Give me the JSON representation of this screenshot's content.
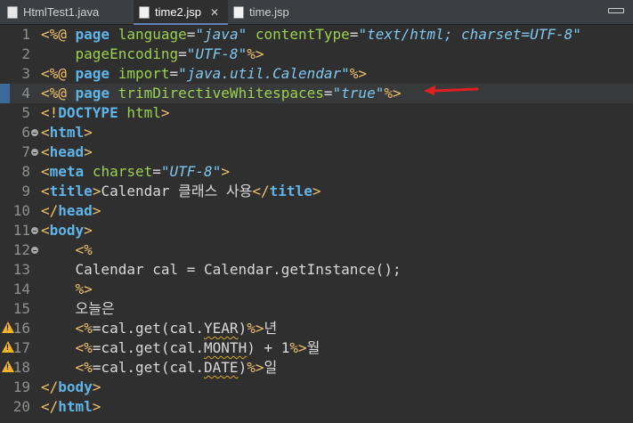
{
  "tabs": [
    {
      "label": "HtmlTest1.java",
      "active": false
    },
    {
      "label": "time2.jsp",
      "active": true,
      "close": "✕"
    },
    {
      "label": "time.jsp",
      "active": false
    }
  ],
  "colors": {
    "directive": "#f0c06a",
    "tag": "#5fb4e8",
    "attribute": "#9bd14f",
    "value": "#7ec7ee",
    "text": "#d9d9d9",
    "arrow": "#e02020",
    "warning": "#f0b323"
  },
  "lines": [
    {
      "num": "1",
      "tokens": [
        [
          "t",
          "<%@ "
        ],
        [
          "tg",
          "page "
        ],
        [
          "a",
          "language"
        ],
        [
          "p",
          "="
        ],
        [
          "v",
          "\"java\""
        ],
        [
          "p",
          " "
        ],
        [
          "a",
          "contentType"
        ],
        [
          "p",
          "="
        ],
        [
          "v",
          "\"text/html; charset=UTF-8\""
        ]
      ]
    },
    {
      "num": "2",
      "tokens": [
        [
          "p",
          "    "
        ],
        [
          "a",
          "pageEncoding"
        ],
        [
          "p",
          "="
        ],
        [
          "v",
          "\"UTF-8\""
        ],
        [
          "t",
          "%>"
        ]
      ]
    },
    {
      "num": "3",
      "tokens": [
        [
          "t",
          "<%@ "
        ],
        [
          "tg",
          "page "
        ],
        [
          "a",
          "import"
        ],
        [
          "p",
          "="
        ],
        [
          "v",
          "\"java.util.Calendar\""
        ],
        [
          "t",
          "%>"
        ]
      ]
    },
    {
      "num": "4",
      "current": true,
      "marker": true,
      "tokens": [
        [
          "t",
          "<%@ "
        ],
        [
          "tg",
          "page "
        ],
        [
          "a",
          "trimDirectiveWhitespaces"
        ],
        [
          "p",
          "="
        ],
        [
          "v",
          "\"true\""
        ],
        [
          "t",
          "%>"
        ]
      ]
    },
    {
      "num": "5",
      "tokens": [
        [
          "t",
          "<!"
        ],
        [
          "tg",
          "DOCTYPE "
        ],
        [
          "a",
          "html"
        ],
        [
          "t",
          ">"
        ]
      ]
    },
    {
      "num": "6",
      "fold": true,
      "tokens": [
        [
          "t",
          "<"
        ],
        [
          "tg",
          "html"
        ],
        [
          "t",
          ">"
        ]
      ]
    },
    {
      "num": "7",
      "fold": true,
      "tokens": [
        [
          "t",
          "<"
        ],
        [
          "tg",
          "head"
        ],
        [
          "t",
          ">"
        ]
      ]
    },
    {
      "num": "8",
      "tokens": [
        [
          "t",
          "<"
        ],
        [
          "tg",
          "meta "
        ],
        [
          "a",
          "charset"
        ],
        [
          "p",
          "="
        ],
        [
          "v",
          "\"UTF-8\""
        ],
        [
          "t",
          ">"
        ]
      ]
    },
    {
      "num": "9",
      "tokens": [
        [
          "t",
          "<"
        ],
        [
          "tg",
          "title"
        ],
        [
          "t",
          ">"
        ],
        [
          "p",
          "Calendar 클래스 사용"
        ],
        [
          "t",
          "</"
        ],
        [
          "tg",
          "title"
        ],
        [
          "t",
          ">"
        ]
      ]
    },
    {
      "num": "10",
      "tokens": [
        [
          "t",
          "</"
        ],
        [
          "tg",
          "head"
        ],
        [
          "t",
          ">"
        ]
      ]
    },
    {
      "num": "11",
      "fold": true,
      "tokens": [
        [
          "t",
          "<"
        ],
        [
          "tg",
          "body"
        ],
        [
          "t",
          ">"
        ]
      ]
    },
    {
      "num": "12",
      "fold": true,
      "tokens": [
        [
          "p",
          "    "
        ],
        [
          "t",
          "<%"
        ]
      ]
    },
    {
      "num": "13",
      "tokens": [
        [
          "p",
          "    Calendar cal = Calendar.getInstance();"
        ]
      ]
    },
    {
      "num": "14",
      "tokens": [
        [
          "p",
          "    "
        ],
        [
          "t",
          "%>"
        ]
      ]
    },
    {
      "num": "15",
      "tokens": [
        [
          "p",
          "    오늘은"
        ]
      ]
    },
    {
      "num": "16",
      "warn": true,
      "tokens": [
        [
          "p",
          "    "
        ],
        [
          "t",
          "<%"
        ],
        [
          "p",
          "=cal.get(cal."
        ],
        [
          "wv",
          "YEAR"
        ],
        [
          "p",
          ")"
        ],
        [
          "t",
          "%>"
        ],
        [
          "p",
          "년"
        ]
      ]
    },
    {
      "num": "17",
      "warn": true,
      "tokens": [
        [
          "p",
          "    "
        ],
        [
          "t",
          "<%"
        ],
        [
          "p",
          "=cal.get(cal."
        ],
        [
          "wv",
          "MONTH"
        ],
        [
          "p",
          ") + 1"
        ],
        [
          "t",
          "%>"
        ],
        [
          "p",
          "월"
        ]
      ]
    },
    {
      "num": "18",
      "warn": true,
      "tokens": [
        [
          "p",
          "    "
        ],
        [
          "t",
          "<%"
        ],
        [
          "p",
          "=cal.get(cal."
        ],
        [
          "wv",
          "DATE"
        ],
        [
          "p",
          ")"
        ],
        [
          "t",
          "%>"
        ],
        [
          "p",
          "일"
        ]
      ]
    },
    {
      "num": "19",
      "tokens": [
        [
          "t",
          "</"
        ],
        [
          "tg",
          "body"
        ],
        [
          "t",
          ">"
        ]
      ]
    },
    {
      "num": "20",
      "tokens": [
        [
          "t",
          "</"
        ],
        [
          "tg",
          "html"
        ],
        [
          "t",
          ">"
        ]
      ]
    }
  ]
}
